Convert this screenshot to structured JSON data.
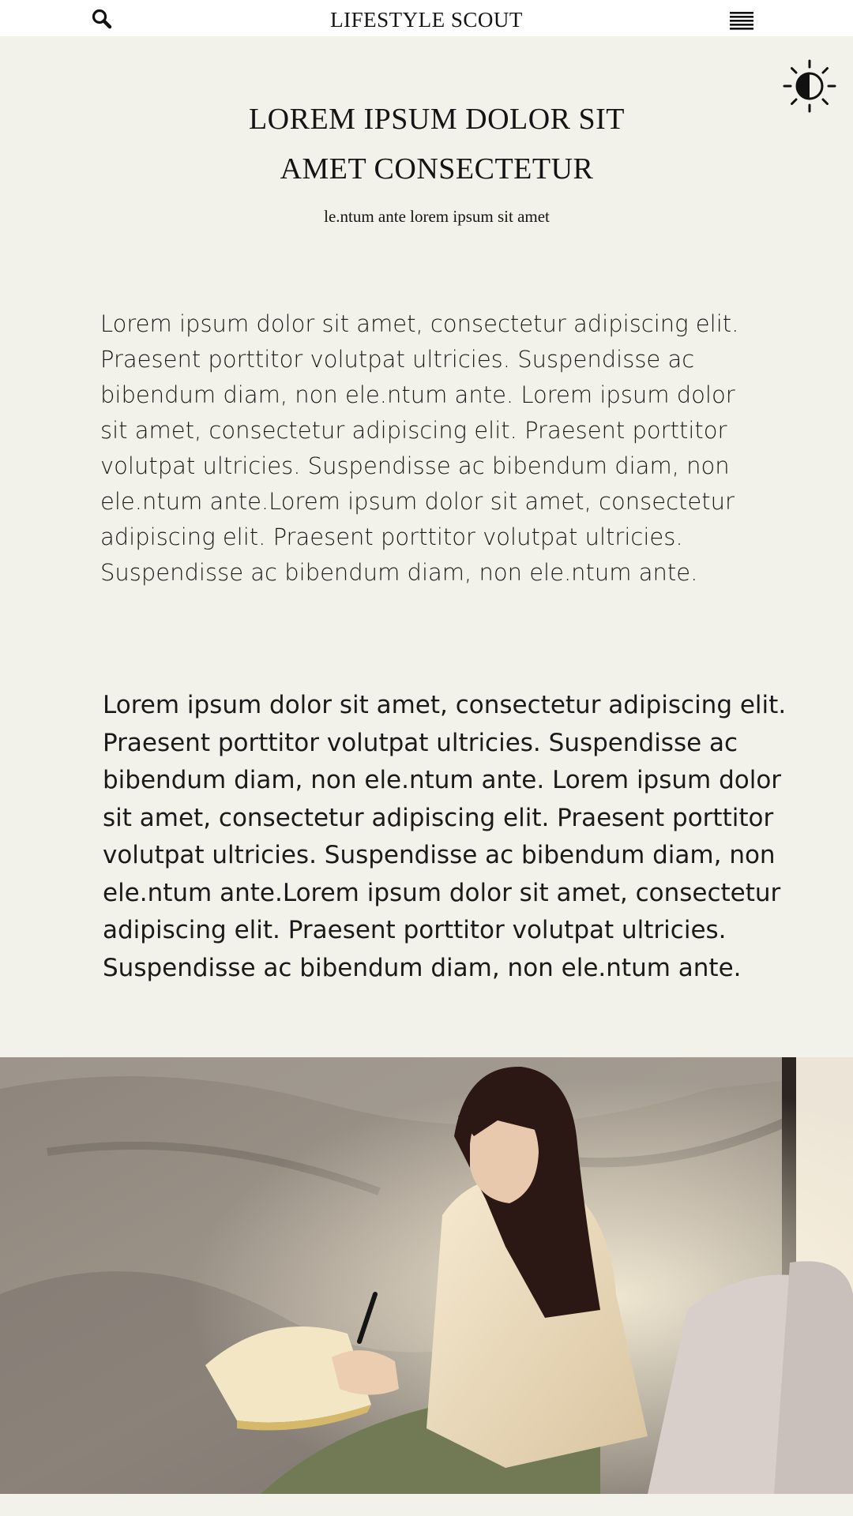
{
  "header": {
    "brand": "LIFESTYLE SCOUT",
    "search_icon": "search-icon",
    "menu_icon": "menu-icon",
    "theme_icon": "contrast-icon"
  },
  "hero": {
    "title_line1": "LOREM IPSUM DOLOR SIT",
    "title_line2": "AMET CONSECTETUR",
    "subtitle": "le.ntum ante lorem ipsum sit amet"
  },
  "article": {
    "paragraph1": "Lorem ipsum dolor sit amet, consectetur adipiscing elit. Praesent porttitor volutpat ultricies. Suspendisse ac bibendum diam, non ele.ntum ante. Lorem ipsum dolor sit amet, consectetur adipiscing elit. Praesent porttitor volutpat ultricies. Suspendisse ac bibendum diam, non ele.ntum ante.Lorem ipsum dolor sit amet, consectetur adipiscing elit. Praesent porttitor volutpat ultricies. Suspendisse ac bibendum diam, non ele.ntum ante.",
    "paragraph2": "Lorem ipsum dolor sit amet, consectetur adipiscing elit. Praesent porttitor volutpat ultricies. Suspendisse ac bibendum diam, non ele.ntum ante. Lorem ipsum dolor sit amet, consectetur adipiscing elit. Praesent porttitor volutpat ultricies. Suspendisse ac bibendum diam, non ele.ntum ante.Lorem ipsum dolor sit amet, consectetur adipiscing elit. Praesent porttitor volutpat ultricies. Suspendisse ac bibendum diam, non ele.ntum ante."
  },
  "colors": {
    "page_background": "#f3f2ea",
    "header_background": "#ffffff",
    "text": "#141414"
  },
  "photo": {
    "subject": "woman-writing-in-book-illustration"
  }
}
